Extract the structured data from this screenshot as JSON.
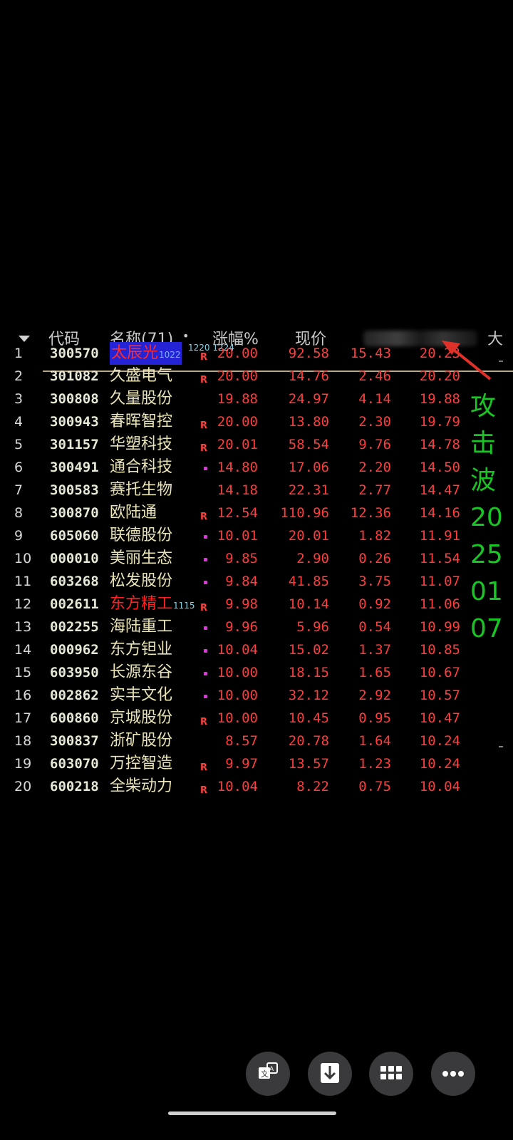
{
  "header": {
    "code": "代码",
    "name": "名称(71)",
    "dot": "•",
    "change": "涨幅%",
    "price": "现价",
    "extra": "大"
  },
  "rows": [
    {
      "idx": "1",
      "code": "300570",
      "name": "太辰光",
      "sup": "1022",
      "flag": "R",
      "c1": "20.00",
      "c2": "92.58",
      "c3": "15.43",
      "c4": "20.23"
    },
    {
      "idx": "2",
      "code": "301082",
      "name": "久盛电气",
      "flag": "R",
      "c1": "20.00",
      "c2": "14.76",
      "c3": "2.46",
      "c4": "20.20"
    },
    {
      "idx": "3",
      "code": "300808",
      "name": "久量股份",
      "c1": "19.88",
      "c2": "24.97",
      "c3": "4.14",
      "c4": "19.88"
    },
    {
      "idx": "4",
      "code": "300943",
      "name": "春晖智控",
      "flag": "R",
      "c1": "20.00",
      "c2": "13.80",
      "c3": "2.30",
      "c4": "19.79"
    },
    {
      "idx": "5",
      "code": "301157",
      "name": "华塑科技",
      "flag": "R",
      "c1": "20.01",
      "c2": "58.54",
      "c3": "9.76",
      "c4": "14.78"
    },
    {
      "idx": "6",
      "code": "300491",
      "name": "通合科技",
      "flag": "•",
      "c1": "14.80",
      "c2": "17.06",
      "c3": "2.20",
      "c4": "14.50"
    },
    {
      "idx": "7",
      "code": "300583",
      "name": "赛托生物",
      "c1": "14.18",
      "c2": "22.31",
      "c3": "2.77",
      "c4": "14.47"
    },
    {
      "idx": "8",
      "code": "300870",
      "name": "欧陆通",
      "flag": "R",
      "c1": "12.54",
      "c2": "110.96",
      "c3": "12.36",
      "c4": "14.16"
    },
    {
      "idx": "9",
      "code": "605060",
      "name": "联德股份",
      "flag": "•",
      "c1": "10.01",
      "c2": "20.01",
      "c3": "1.82",
      "c4": "11.91"
    },
    {
      "idx": "10",
      "code": "000010",
      "name": "美丽生态",
      "flag": "•",
      "c1": "9.85",
      "c2": "2.90",
      "c3": "0.26",
      "c4": "11.54"
    },
    {
      "idx": "11",
      "code": "603268",
      "name": "松发股份",
      "flag": "•",
      "c1": "9.84",
      "c2": "41.85",
      "c3": "3.75",
      "c4": "11.07"
    },
    {
      "idx": "12",
      "code": "002611",
      "name": "东方精工",
      "sup": "1115",
      "flag": "R",
      "c1": "9.98",
      "c2": "10.14",
      "c3": "0.92",
      "c4": "11.06"
    },
    {
      "idx": "13",
      "code": "002255",
      "name": "海陆重工",
      "flag": "•",
      "c1": "9.96",
      "c2": "5.96",
      "c3": "0.54",
      "c4": "10.99"
    },
    {
      "idx": "14",
      "code": "000962",
      "name": "东方钽业",
      "flag": "•",
      "c1": "10.04",
      "c2": "15.02",
      "c3": "1.37",
      "c4": "10.85"
    },
    {
      "idx": "15",
      "code": "603950",
      "name": "长源东谷",
      "flag": "•",
      "c1": "10.00",
      "c2": "18.15",
      "c3": "1.65",
      "c4": "10.67"
    },
    {
      "idx": "16",
      "code": "002862",
      "name": "实丰文化",
      "flag": "•",
      "c1": "10.00",
      "c2": "32.12",
      "c3": "2.92",
      "c4": "10.57"
    },
    {
      "idx": "17",
      "code": "600860",
      "name": "京城股份",
      "flag": "R",
      "c1": "10.00",
      "c2": "10.45",
      "c3": "0.95",
      "c4": "10.47"
    },
    {
      "idx": "18",
      "code": "300837",
      "name": "浙矿股份",
      "c1": "8.57",
      "c2": "20.78",
      "c3": "1.64",
      "c4": "10.24"
    },
    {
      "idx": "19",
      "code": "603070",
      "name": "万控智造",
      "flag": "R",
      "c1": "9.97",
      "c2": "13.57",
      "c3": "1.23",
      "c4": "10.24"
    },
    {
      "idx": "20",
      "code": "600218",
      "name": "全柴动力",
      "flag": "R",
      "c1": "10.04",
      "c2": "8.22",
      "c3": "0.75",
      "c4": "10.04"
    }
  ],
  "overlay_labels": "1220  1224",
  "annotation": [
    "攻",
    "击",
    "波",
    "20",
    "25",
    "01",
    "07"
  ],
  "buttons": [
    {
      "icon": "translate-icon"
    },
    {
      "icon": "download-icon"
    },
    {
      "icon": "grid-icon"
    },
    {
      "icon": "more-icon"
    }
  ],
  "colors": {
    "up": "#ff3c3c",
    "name": "#e9e3b8",
    "annotation": "#19c425",
    "selection": "#2424d6"
  }
}
